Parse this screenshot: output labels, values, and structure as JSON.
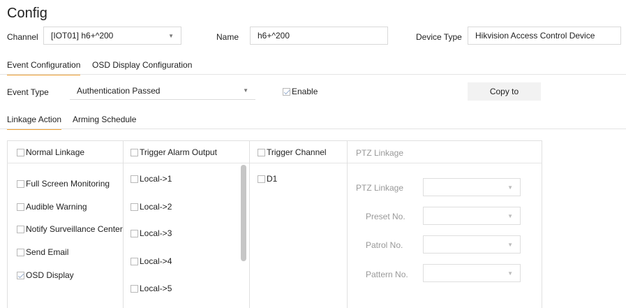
{
  "page_title": "Config",
  "top": {
    "channel_label": "Channel",
    "channel_value": "[IOT01] h6+^200",
    "name_label": "Name",
    "name_value": "h6+^200",
    "device_type_label": "Device Type",
    "device_type_value": "Hikvision Access Control Device"
  },
  "tabs": [
    {
      "label": "Event Configuration",
      "active": true
    },
    {
      "label": "OSD Display Configuration",
      "active": false
    }
  ],
  "event": {
    "type_label": "Event Type",
    "type_value": "Authentication Passed",
    "enable_label": "Enable",
    "copy_button": "Copy to"
  },
  "subtabs": [
    {
      "label": "Linkage Action",
      "active": true
    },
    {
      "label": "Arming Schedule",
      "active": false
    }
  ],
  "linkage": {
    "normal_header": "Normal Linkage",
    "alarm_header": "Trigger Alarm Output",
    "channel_header": "Trigger Channel",
    "ptz_header": "PTZ Linkage",
    "normal_items": [
      {
        "label": "Full Screen Monitoring",
        "checked": false
      },
      {
        "label": "Audible Warning",
        "checked": false
      },
      {
        "label": "Notify Surveillance Center",
        "checked": false
      },
      {
        "label": "Send Email",
        "checked": false
      },
      {
        "label": "OSD Display",
        "checked": true
      }
    ],
    "alarm_outputs": [
      "Local->1",
      "Local->2",
      "Local->3",
      "Local->4",
      "Local->5"
    ],
    "channels": [
      "D1"
    ],
    "ptz_fields": [
      "PTZ Linkage",
      "Preset No.",
      "Patrol No.",
      "Pattern No."
    ]
  }
}
